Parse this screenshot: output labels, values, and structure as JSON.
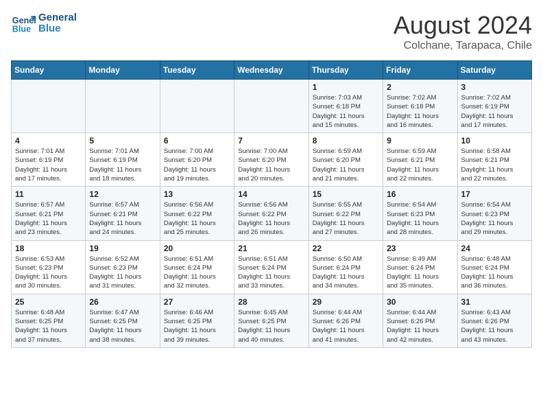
{
  "header": {
    "logo_line1": "General",
    "logo_line2": "Blue",
    "month": "August 2024",
    "location": "Colchane, Tarapaca, Chile"
  },
  "weekdays": [
    "Sunday",
    "Monday",
    "Tuesday",
    "Wednesday",
    "Thursday",
    "Friday",
    "Saturday"
  ],
  "weeks": [
    [
      {
        "day": "",
        "info": ""
      },
      {
        "day": "",
        "info": ""
      },
      {
        "day": "",
        "info": ""
      },
      {
        "day": "",
        "info": ""
      },
      {
        "day": "1",
        "info": "Sunrise: 7:03 AM\nSunset: 6:18 PM\nDaylight: 11 hours\nand 15 minutes."
      },
      {
        "day": "2",
        "info": "Sunrise: 7:02 AM\nSunset: 6:18 PM\nDaylight: 11 hours\nand 16 minutes."
      },
      {
        "day": "3",
        "info": "Sunrise: 7:02 AM\nSunset: 6:19 PM\nDaylight: 11 hours\nand 17 minutes."
      }
    ],
    [
      {
        "day": "4",
        "info": "Sunrise: 7:01 AM\nSunset: 6:19 PM\nDaylight: 11 hours\nand 17 minutes."
      },
      {
        "day": "5",
        "info": "Sunrise: 7:01 AM\nSunset: 6:19 PM\nDaylight: 11 hours\nand 18 minutes."
      },
      {
        "day": "6",
        "info": "Sunrise: 7:00 AM\nSunset: 6:20 PM\nDaylight: 11 hours\nand 19 minutes."
      },
      {
        "day": "7",
        "info": "Sunrise: 7:00 AM\nSunset: 6:20 PM\nDaylight: 11 hours\nand 20 minutes."
      },
      {
        "day": "8",
        "info": "Sunrise: 6:59 AM\nSunset: 6:20 PM\nDaylight: 11 hours\nand 21 minutes."
      },
      {
        "day": "9",
        "info": "Sunrise: 6:59 AM\nSunset: 6:21 PM\nDaylight: 11 hours\nand 22 minutes."
      },
      {
        "day": "10",
        "info": "Sunrise: 6:58 AM\nSunset: 6:21 PM\nDaylight: 11 hours\nand 22 minutes."
      }
    ],
    [
      {
        "day": "11",
        "info": "Sunrise: 6:57 AM\nSunset: 6:21 PM\nDaylight: 11 hours\nand 23 minutes."
      },
      {
        "day": "12",
        "info": "Sunrise: 6:57 AM\nSunset: 6:21 PM\nDaylight: 11 hours\nand 24 minutes."
      },
      {
        "day": "13",
        "info": "Sunrise: 6:56 AM\nSunset: 6:22 PM\nDaylight: 11 hours\nand 25 minutes."
      },
      {
        "day": "14",
        "info": "Sunrise: 6:56 AM\nSunset: 6:22 PM\nDaylight: 11 hours\nand 26 minutes."
      },
      {
        "day": "15",
        "info": "Sunrise: 6:55 AM\nSunset: 6:22 PM\nDaylight: 11 hours\nand 27 minutes."
      },
      {
        "day": "16",
        "info": "Sunrise: 6:54 AM\nSunset: 6:23 PM\nDaylight: 11 hours\nand 28 minutes."
      },
      {
        "day": "17",
        "info": "Sunrise: 6:54 AM\nSunset: 6:23 PM\nDaylight: 11 hours\nand 29 minutes."
      }
    ],
    [
      {
        "day": "18",
        "info": "Sunrise: 6:53 AM\nSunset: 6:23 PM\nDaylight: 11 hours\nand 30 minutes."
      },
      {
        "day": "19",
        "info": "Sunrise: 6:52 AM\nSunset: 6:23 PM\nDaylight: 11 hours\nand 31 minutes."
      },
      {
        "day": "20",
        "info": "Sunrise: 6:51 AM\nSunset: 6:24 PM\nDaylight: 11 hours\nand 32 minutes."
      },
      {
        "day": "21",
        "info": "Sunrise: 6:51 AM\nSunset: 6:24 PM\nDaylight: 11 hours\nand 33 minutes."
      },
      {
        "day": "22",
        "info": "Sunrise: 6:50 AM\nSunset: 6:24 PM\nDaylight: 11 hours\nand 34 minutes."
      },
      {
        "day": "23",
        "info": "Sunrise: 6:49 AM\nSunset: 6:24 PM\nDaylight: 11 hours\nand 35 minutes."
      },
      {
        "day": "24",
        "info": "Sunrise: 6:48 AM\nSunset: 6:24 PM\nDaylight: 11 hours\nand 36 minutes."
      }
    ],
    [
      {
        "day": "25",
        "info": "Sunrise: 6:48 AM\nSunset: 6:25 PM\nDaylight: 11 hours\nand 37 minutes."
      },
      {
        "day": "26",
        "info": "Sunrise: 6:47 AM\nSunset: 6:25 PM\nDaylight: 11 hours\nand 38 minutes."
      },
      {
        "day": "27",
        "info": "Sunrise: 6:46 AM\nSunset: 6:25 PM\nDaylight: 11 hours\nand 39 minutes."
      },
      {
        "day": "28",
        "info": "Sunrise: 6:45 AM\nSunset: 6:25 PM\nDaylight: 11 hours\nand 40 minutes."
      },
      {
        "day": "29",
        "info": "Sunrise: 6:44 AM\nSunset: 6:26 PM\nDaylight: 11 hours\nand 41 minutes."
      },
      {
        "day": "30",
        "info": "Sunrise: 6:44 AM\nSunset: 6:26 PM\nDaylight: 11 hours\nand 42 minutes."
      },
      {
        "day": "31",
        "info": "Sunrise: 6:43 AM\nSunset: 6:26 PM\nDaylight: 11 hours\nand 43 minutes."
      }
    ]
  ]
}
